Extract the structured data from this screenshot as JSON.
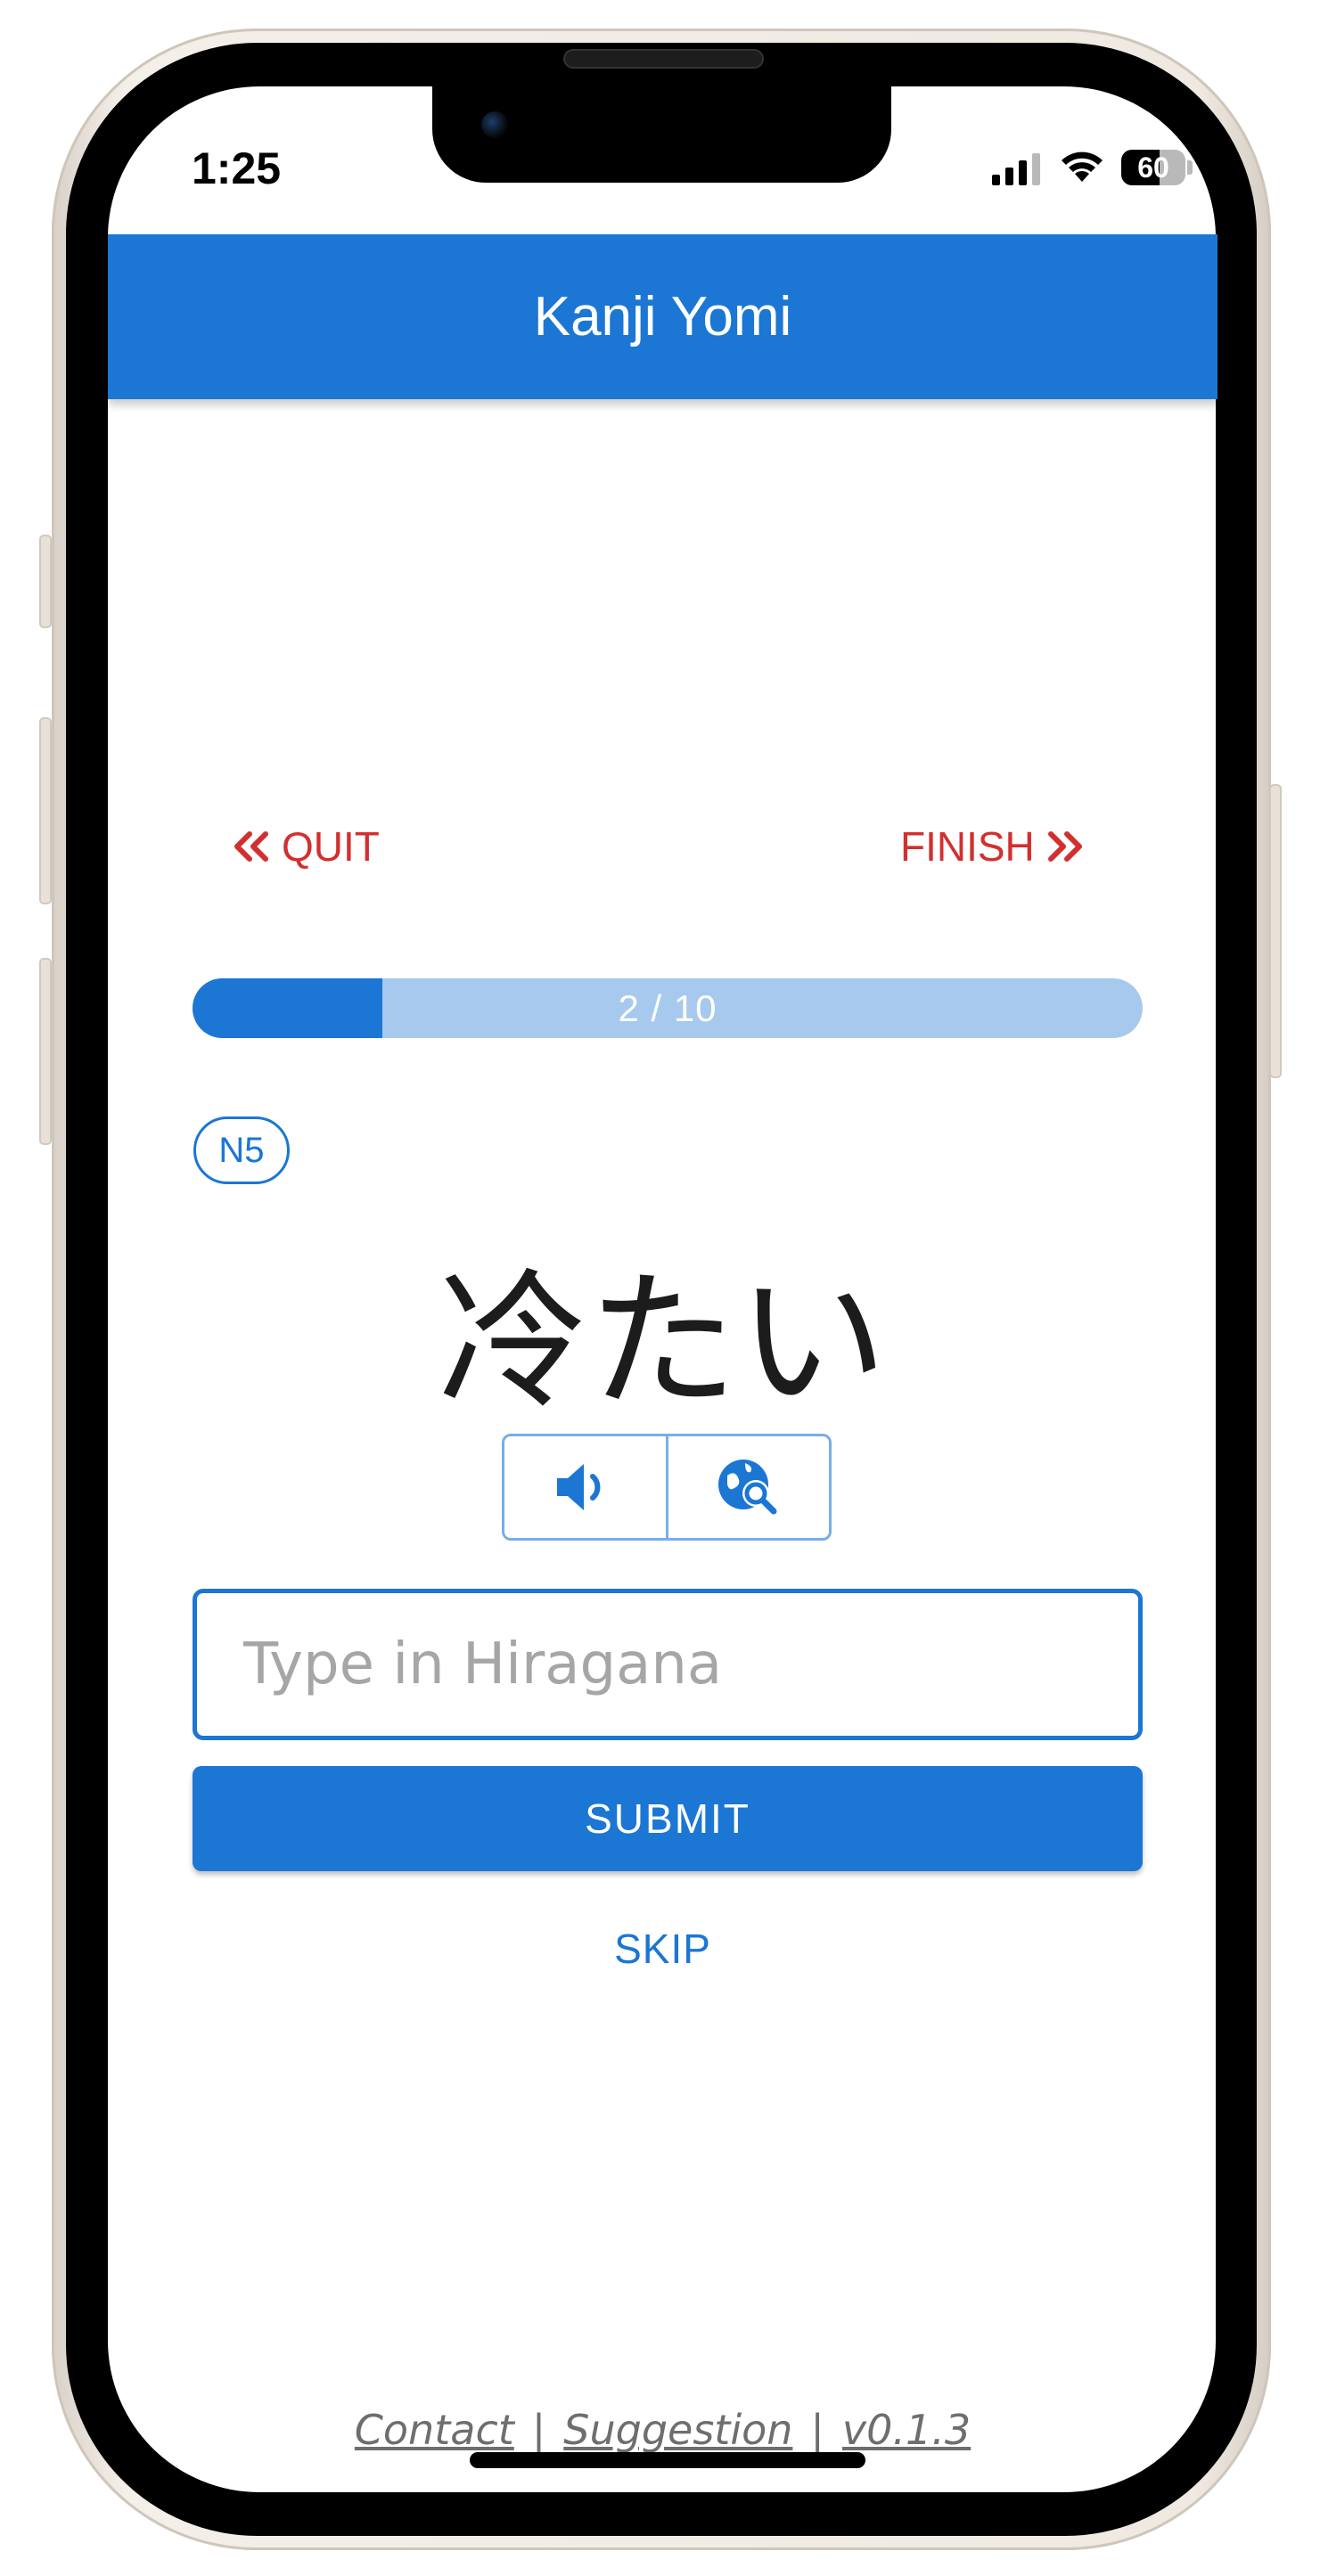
{
  "status_bar": {
    "time": "1:25",
    "battery": "60"
  },
  "app_bar": {
    "title": "Kanji Yomi"
  },
  "navigation": {
    "quit_label": "QUIT",
    "finish_label": "FINISH"
  },
  "progress": {
    "current": 2,
    "total": 10,
    "label": "2 / 10",
    "fraction": 0.2
  },
  "question": {
    "level": "N5",
    "word": "冷たい"
  },
  "tools": {
    "audio_icon": "speaker-volume-icon",
    "lookup_icon": "globe-search-icon"
  },
  "answer": {
    "value": "",
    "placeholder": "Type in Hiragana"
  },
  "actions": {
    "submit_label": "SUBMIT",
    "skip_label": "SKIP"
  },
  "footer": {
    "contact": "Contact",
    "suggestion": "Suggestion",
    "version": "v0.1.3",
    "separator": "|"
  },
  "colors": {
    "primary": "#1b76d4",
    "primary_light": "#a7c9ee",
    "danger": "#d32f2f"
  }
}
